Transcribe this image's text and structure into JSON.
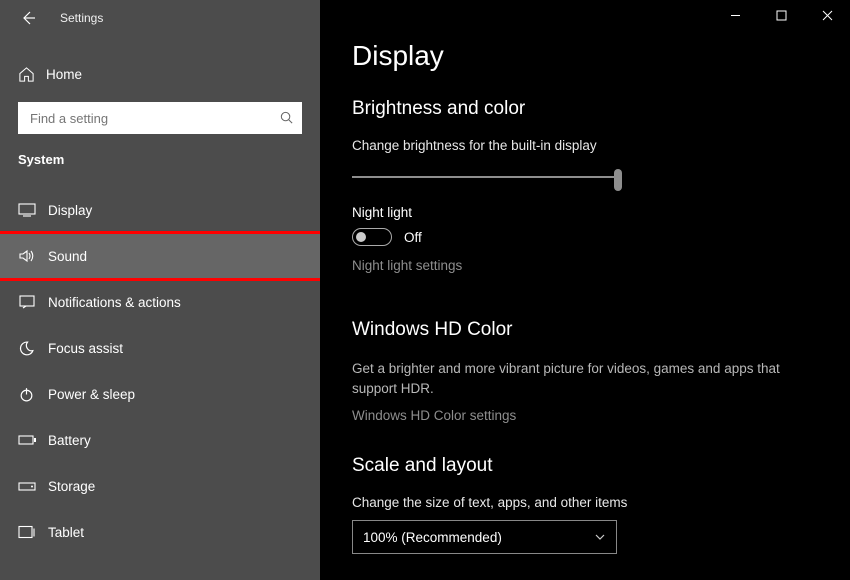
{
  "window": {
    "title": "Settings"
  },
  "sidebar": {
    "home_label": "Home",
    "search_placeholder": "Find a setting",
    "section_label": "System",
    "items": [
      {
        "label": "Display"
      },
      {
        "label": "Sound"
      },
      {
        "label": "Notifications & actions"
      },
      {
        "label": "Focus assist"
      },
      {
        "label": "Power & sleep"
      },
      {
        "label": "Battery"
      },
      {
        "label": "Storage"
      },
      {
        "label": "Tablet"
      }
    ]
  },
  "main": {
    "page_title": "Display",
    "brightness": {
      "title": "Brightness and color",
      "slider_label": "Change brightness for the built-in display",
      "slider_value_pct": 100,
      "night_light_label": "Night light",
      "night_light_state": "Off",
      "night_light_link": "Night light settings"
    },
    "hd_color": {
      "title": "Windows HD Color",
      "desc": "Get a brighter and more vibrant picture for videos, games and apps that support HDR.",
      "link": "Windows HD Color settings"
    },
    "scale": {
      "title": "Scale and layout",
      "label": "Change the size of text, apps, and other items",
      "selected": "100% (Recommended)"
    }
  }
}
